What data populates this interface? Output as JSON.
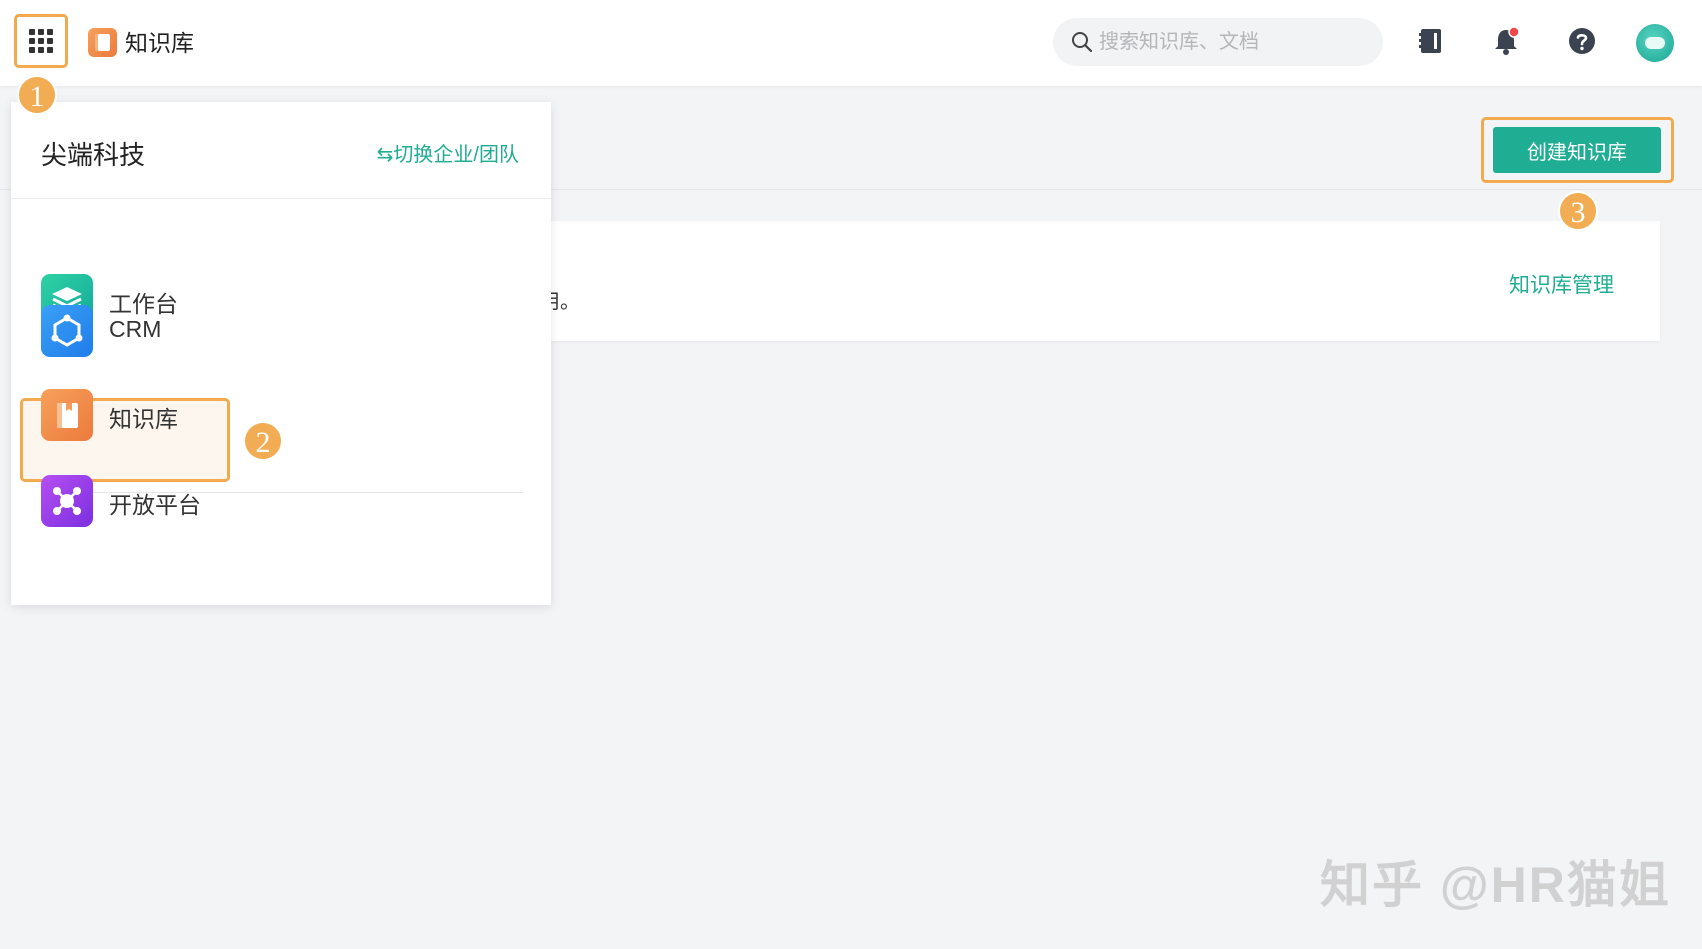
{
  "header": {
    "app_name": "知识库",
    "search_placeholder": "搜索知识库、文档",
    "icons": {
      "grid": "apps-grid-icon",
      "app_logo": "book-icon",
      "search": "search-icon",
      "contacts": "address-book-icon",
      "notifications": "bell-icon",
      "help": "help-icon",
      "avatar": "user-avatar"
    }
  },
  "badges": [
    "1",
    "2",
    "3"
  ],
  "panel": {
    "org_name": "尖端科技",
    "switch_label": "⇆切换企业/团队",
    "items": [
      {
        "label": "工作台",
        "icon": "layers-icon"
      },
      {
        "label": "CRM",
        "icon": "hexagon-network-icon"
      },
      {
        "label": "知识库",
        "icon": "book-icon"
      },
      {
        "label": "开放平台",
        "icon": "nodes-icon"
      }
    ]
  },
  "main": {
    "create_label": "创建知识库",
    "card_desc": "用。",
    "card_link": "知识库管理"
  },
  "watermark": "知乎 @HR猫姐",
  "colors": {
    "accent": "#1fad93",
    "highlight": "#f3a94e",
    "notification_dot": "#f04848"
  }
}
